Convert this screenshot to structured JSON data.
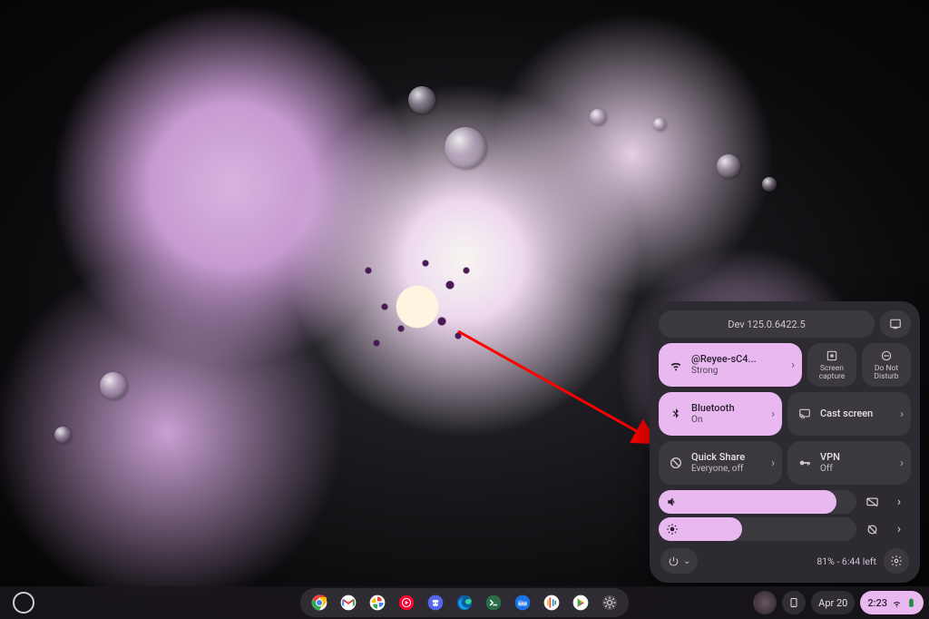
{
  "colors": {
    "accent": "#e9b8f0",
    "panel": "#2d2a31",
    "tile": "#3b383e"
  },
  "qs": {
    "version": "Dev 125.0.6422.5",
    "tiles": {
      "wifi": {
        "label": "@Reyee-sC4...",
        "sub": "Strong",
        "active": true,
        "icon": "wifi-icon"
      },
      "screencap": {
        "label": "Screen capture",
        "icon": "screen-capture-icon"
      },
      "dnd": {
        "label": "Do Not Disturb",
        "icon": "do-not-disturb-icon"
      },
      "bluetooth": {
        "label": "Bluetooth",
        "sub": "On",
        "active": true,
        "icon": "bluetooth-icon"
      },
      "cast": {
        "label": "Cast screen",
        "icon": "cast-icon"
      },
      "quickshare": {
        "label": "Quick Share",
        "sub": "Everyone, off",
        "active": false,
        "icon": "quick-share-icon"
      },
      "vpn": {
        "label": "VPN",
        "sub": "Off",
        "active": false,
        "icon": "vpn-icon"
      }
    },
    "volume_pct": 90,
    "brightness_pct": 42,
    "battery": "81% - 6:44 left"
  },
  "shelf": {
    "apps": [
      {
        "name": "chrome",
        "bg": "#ffffff"
      },
      {
        "name": "gmail",
        "bg": "#ffffff"
      },
      {
        "name": "photos",
        "bg": "#ffffff"
      },
      {
        "name": "yt-music",
        "bg": "#ff0033"
      },
      {
        "name": "discord",
        "bg": "#5865F2"
      },
      {
        "name": "edge",
        "bg": "#1b9de2"
      },
      {
        "name": "terminal",
        "bg": "#2c6e49"
      },
      {
        "name": "files",
        "bg": "#1a73e8"
      },
      {
        "name": "podcasts",
        "bg": "#ffffff"
      },
      {
        "name": "play-store",
        "bg": "#ffffff"
      },
      {
        "name": "settings",
        "bg": "#3b383e"
      }
    ],
    "date": "Apr 20",
    "time": "2:23"
  }
}
